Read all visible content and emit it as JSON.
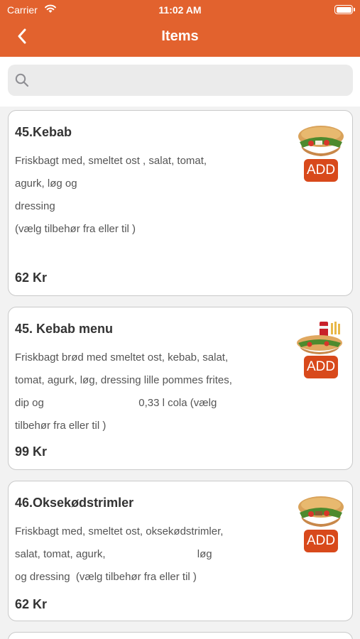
{
  "status": {
    "carrier": "Carrier",
    "time": "11:02 AM"
  },
  "nav": {
    "title": "Items"
  },
  "search": {
    "placeholder": ""
  },
  "items": [
    {
      "name": "45.Kebab",
      "desc": [
        "Friskbagt med, smeltet ost , salat, tomat,",
        "agurk, løg og",
        "dressing",
        "(vælg tilbehør fra eller til )"
      ],
      "price": "62 Kr",
      "add_label": "ADD"
    },
    {
      "name": "45. Kebab menu",
      "desc": [
        "Friskbagt brød med smeltet ost, kebab, salat,",
        "tomat, agurk, løg, dressing lille pommes frites,",
        "dip og                                0,33 l cola (vælg",
        "tilbehør fra eller til )"
      ],
      "price": "99 Kr",
      "add_label": "ADD"
    },
    {
      "name": "46.Oksekødstrimler",
      "desc": [
        "Friskbagt med, smeltet ost, oksekødstrimler,",
        "salat, tomat, agurk,                               løg",
        "og dressing  (vælg tilbehør fra eller til )"
      ],
      "price": "62 Kr",
      "add_label": "ADD"
    }
  ]
}
